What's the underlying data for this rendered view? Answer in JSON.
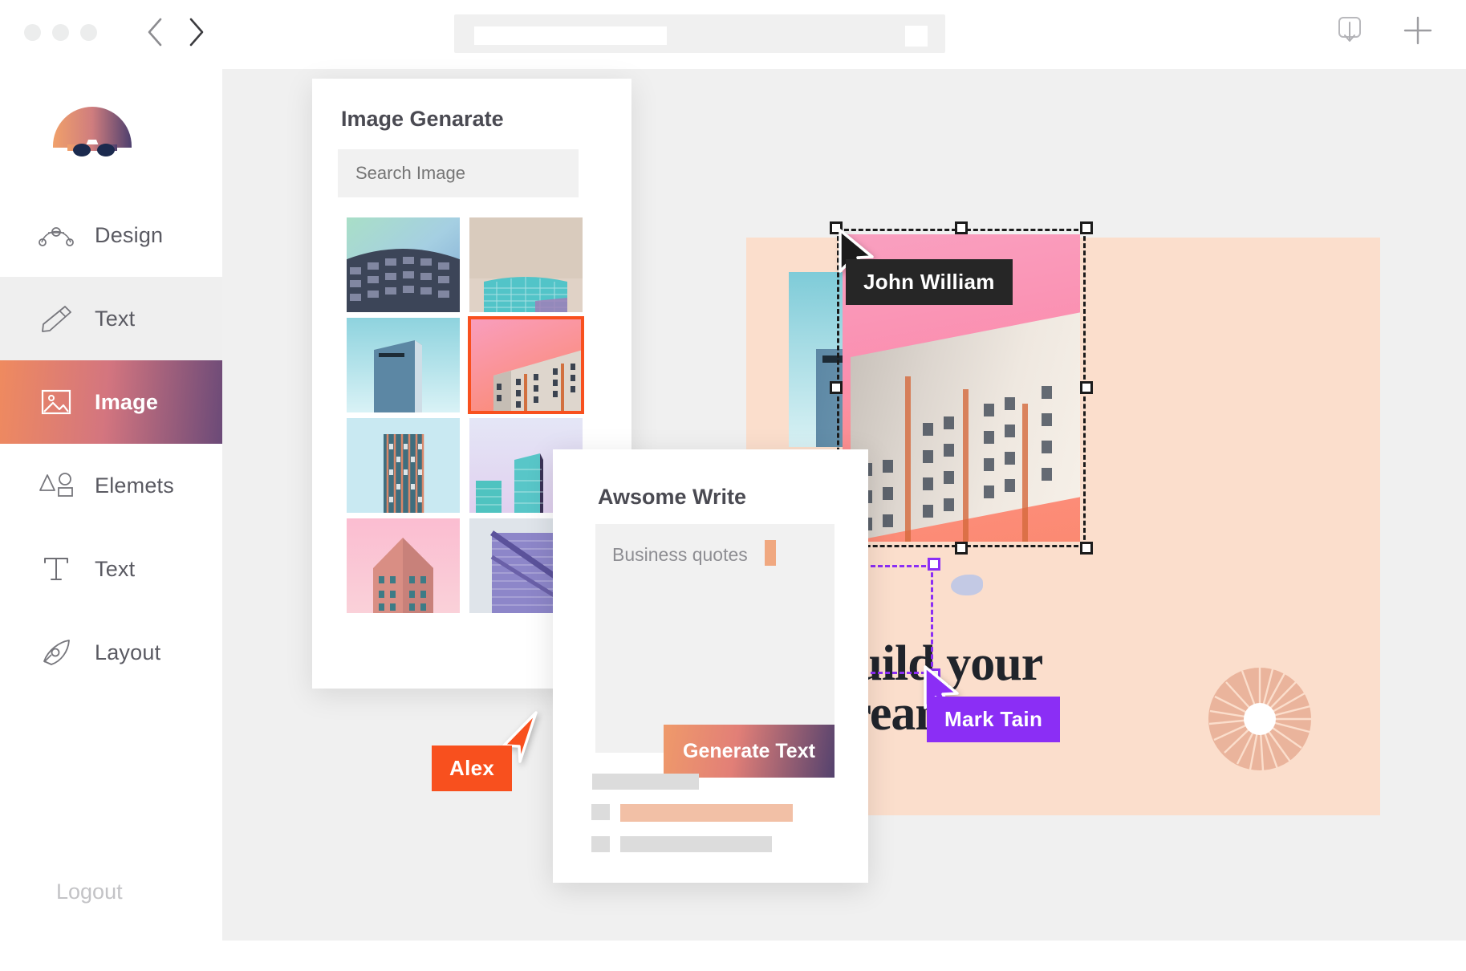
{
  "app": {
    "window_dots": [
      "dot-1",
      "dot-2",
      "dot-3"
    ],
    "nav_back_icon": "chevron-left-icon",
    "nav_forward_icon": "chevron-right-icon",
    "address_bar_value": "",
    "download_icon": "download-icon",
    "add_icon": "plus-icon"
  },
  "sidebar": {
    "logo_name": "brand-logo",
    "items": [
      {
        "label": "Design",
        "icon": "bezier-curve-icon",
        "state": "default"
      },
      {
        "label": "Text",
        "icon": "pencil-icon",
        "state": "hovered"
      },
      {
        "label": "Image",
        "icon": "image-icon",
        "state": "active"
      },
      {
        "label": "Elemets",
        "icon": "shapes-icon",
        "state": "default"
      },
      {
        "label": "Text",
        "icon": "type-t-icon",
        "state": "default"
      },
      {
        "label": "Layout",
        "icon": "pen-nib-icon",
        "state": "default"
      }
    ],
    "logout_label": "Logout",
    "active_gradient_from": "#ef8a5f",
    "active_gradient_to": "#6b4a78"
  },
  "image_panel": {
    "title": "Image Genarate",
    "search_placeholder": "Search Image",
    "search_value": "",
    "selected_index": 3,
    "thumbs": [
      {
        "name": "curved-glass-tower",
        "selected": false
      },
      {
        "name": "teal-round-tower",
        "selected": false
      },
      {
        "name": "blue-monolith-tower",
        "selected": false
      },
      {
        "name": "pink-apartment-block",
        "selected": true
      },
      {
        "name": "red-grid-highrise",
        "selected": false
      },
      {
        "name": "lilac-glass-towers",
        "selected": false
      },
      {
        "name": "pink-corner-tower",
        "selected": false
      },
      {
        "name": "violet-diagonal-facade",
        "selected": false
      }
    ]
  },
  "write_panel": {
    "title": "Awsome Write",
    "input_value": "Business quotes",
    "caret_color": "#f0a880",
    "generate_button_label": "Generate Text",
    "skeleton_rows": 3
  },
  "canvas": {
    "artboard_bg": "#fbdecc",
    "headline_line1": "Build your",
    "headline_line2": "dream",
    "selected_layer_name": "pink-apartment-image",
    "text_layer_name": "headline-text-layer"
  },
  "collaborators": [
    {
      "name": "John William",
      "color": "#262626",
      "cursor": "arrow-cursor-black"
    },
    {
      "name": "Alex",
      "color": "#f8501e",
      "cursor": "arrow-cursor-orange"
    },
    {
      "name": "Mark Tain",
      "color": "#8b2ef5",
      "cursor": "arrow-cursor-purple"
    }
  ]
}
